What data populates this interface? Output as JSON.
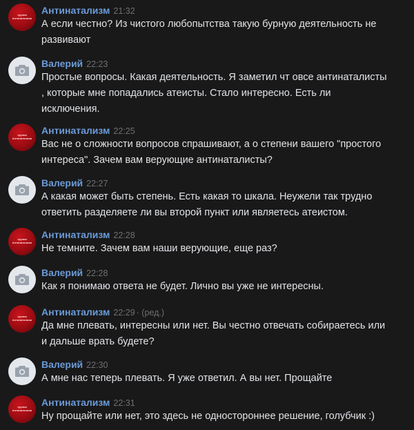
{
  "messages": [
    {
      "author": "Антинатализм",
      "time": "21:32",
      "edited": "",
      "avatar": "red",
      "text": "А если честно? Из чистого любопытства такую бурную деятельность не\nразвивают"
    },
    {
      "author": "Валерий",
      "time": "22:23",
      "edited": "",
      "avatar": "gray",
      "text": "Простые вопросы. Какая деятельность. Я заметил чт овсе антинаталисты\n, которые мне попадались атеисты. Стало интересно. Есть ли\nисключения."
    },
    {
      "author": "Антинатализм",
      "time": "22:25",
      "edited": "",
      "avatar": "red",
      "text": "Вас не о сложности вопросов спрашивают, а о степени вашего \"простого\nинтереса\". Зачем вам верующие антинаталисты?"
    },
    {
      "author": "Валерий",
      "time": "22:27",
      "edited": "",
      "avatar": "gray",
      "text": "А какая может быть степень. Есть какая то шкала. Неужели так трудно\nответить разделяете ли вы второй пункт или являетесь атеистом."
    },
    {
      "author": "Антинатализм",
      "time": "22:28",
      "edited": "",
      "avatar": "red",
      "text": "Не темните. Зачем вам наши верующие, еще раз?"
    },
    {
      "author": "Валерий",
      "time": "22:28",
      "edited": "",
      "avatar": "gray",
      "text": "Как я понимаю ответа не будет. Лично вы уже не интересны."
    },
    {
      "author": "Антинатализм",
      "time": "22:29",
      "edited": "· (ред.)",
      "avatar": "red",
      "text": "Да мне плевать, интересны или нет. Вы честно отвечать собираетесь или\nи дальше врать будете?"
    },
    {
      "author": "Валерий",
      "time": "22:30",
      "edited": "",
      "avatar": "gray",
      "text": "А мне нас теперь плевать. Я уже ответил. А вы нет. Прощайте"
    },
    {
      "author": "Антинатализм",
      "time": "22:31",
      "edited": "",
      "avatar": "red",
      "text": "Ну прощайте или нет, это здесь не одностороннее решение, голубчик :)"
    }
  ],
  "avatar_logo": {
    "line1": "группа",
    "line2": "Антинатализм"
  },
  "icons": {
    "gray_avatar": "camera-icon"
  },
  "colors": {
    "background": "#19191a",
    "author": "#6b9bd8",
    "time": "#6f6f72",
    "text": "#e1e3e6",
    "avatar_red": "#b3101a",
    "avatar_gray": "#e4e8ed"
  }
}
